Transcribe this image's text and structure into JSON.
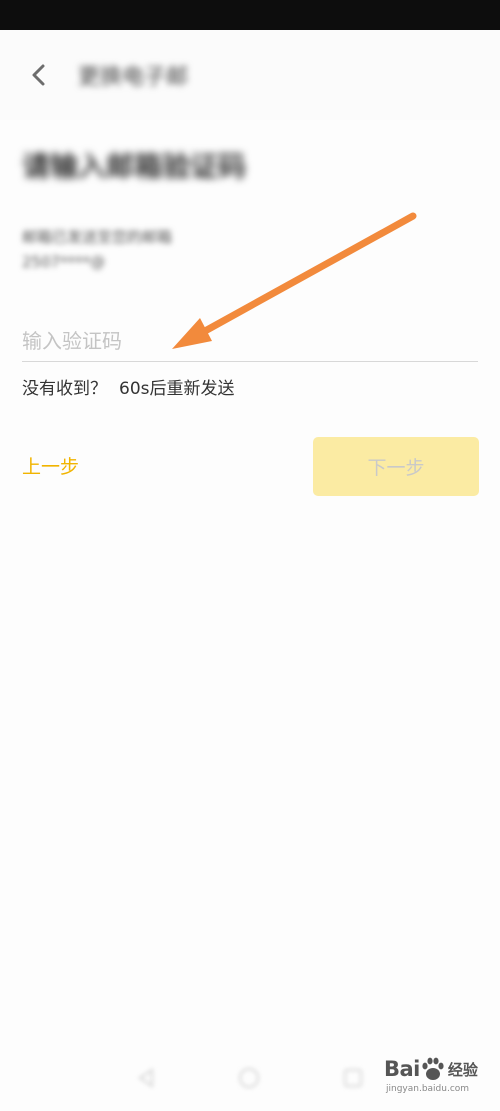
{
  "app_bar": {
    "title": "更换电子邮"
  },
  "page": {
    "heading": "请输入邮箱验证码",
    "hint_line1": "邮箱已发送至您的邮箱",
    "hint_line2": "2507****@"
  },
  "code_input": {
    "placeholder": "输入验证码",
    "value": ""
  },
  "resend": {
    "question": "没有收到？",
    "countdown": "60s后重新发送"
  },
  "actions": {
    "prev_label": "上一步",
    "next_label": "下一步"
  },
  "colors": {
    "accent": "#f1b400",
    "next_button_disabled": "#fbeba3",
    "annotation_arrow": "#f28a3c"
  },
  "icons": {
    "back": "back-chevron-icon",
    "annotation": "annotation-arrow-icon",
    "nav_back": "nav-back-icon",
    "nav_home": "nav-home-icon",
    "nav_recent": "nav-recent-icon"
  },
  "watermark": {
    "logo_prefix": "Bai",
    "logo_suffix": "经验",
    "domain": "jingyan.baidu.com"
  }
}
